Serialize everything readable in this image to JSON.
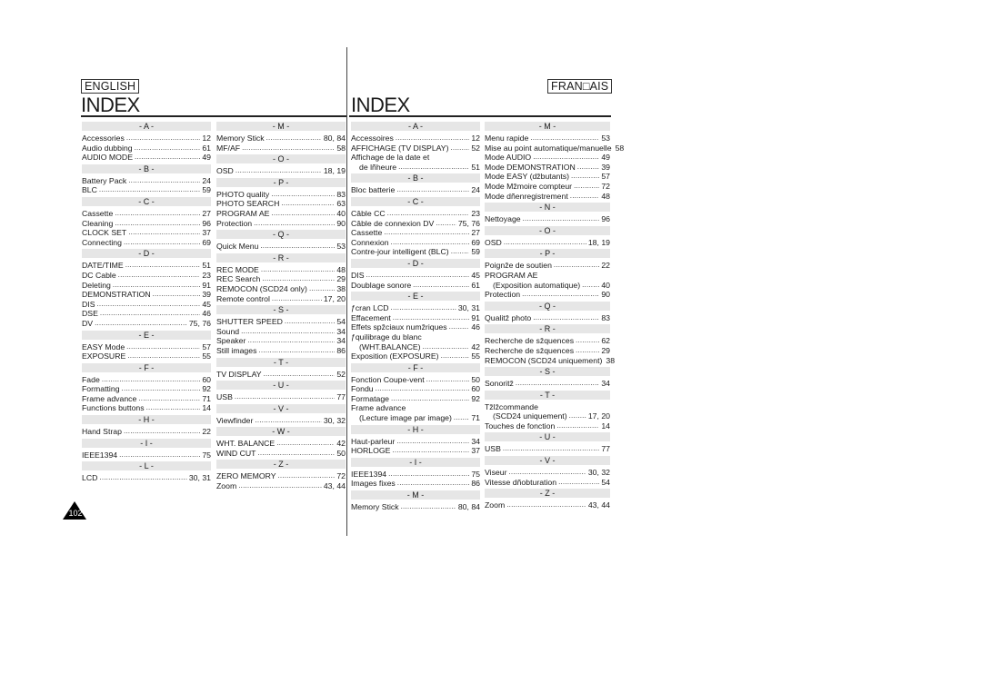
{
  "english": {
    "language_label": "ENGLISH",
    "title": "INDEX",
    "columns": [
      [
        {
          "type": "header",
          "text": "- A -"
        },
        {
          "label": "Accessories",
          "page": "12"
        },
        {
          "label": "Audio dubbing",
          "page": "61"
        },
        {
          "label": "AUDIO MODE",
          "page": "49"
        },
        {
          "type": "header",
          "text": "- B -"
        },
        {
          "label": "Battery Pack",
          "page": "24"
        },
        {
          "label": "BLC",
          "page": "59"
        },
        {
          "type": "header",
          "text": "- C -"
        },
        {
          "label": "Cassette",
          "page": "27"
        },
        {
          "label": "Cleaning",
          "page": "96"
        },
        {
          "label": "CLOCK SET",
          "page": "37"
        },
        {
          "label": "Connecting",
          "page": "69"
        },
        {
          "type": "header",
          "text": "- D -"
        },
        {
          "label": "DATE/TIME",
          "page": "51"
        },
        {
          "label": "DC Cable",
          "page": "23"
        },
        {
          "label": "Deleting",
          "page": "91"
        },
        {
          "label": "DEMONSTRATION",
          "page": "39"
        },
        {
          "label": "DIS",
          "page": "45"
        },
        {
          "label": "DSE",
          "page": "46"
        },
        {
          "label": "DV",
          "page": "75, 76"
        },
        {
          "type": "header",
          "text": "- E -"
        },
        {
          "label": "EASY Mode",
          "page": "57"
        },
        {
          "label": "EXPOSURE",
          "page": "55"
        },
        {
          "type": "header",
          "text": "- F -"
        },
        {
          "label": "Fade",
          "page": "60"
        },
        {
          "label": "Formatting",
          "page": "92"
        },
        {
          "label": "Frame advance",
          "page": "71"
        },
        {
          "label": "Functions buttons",
          "page": "14"
        },
        {
          "type": "header",
          "text": "- H -"
        },
        {
          "label": "Hand Strap",
          "page": "22"
        },
        {
          "type": "header",
          "text": "- I -"
        },
        {
          "label": "IEEE1394",
          "page": "75"
        },
        {
          "type": "header",
          "text": "- L -"
        },
        {
          "label": "LCD",
          "page": "30, 31"
        }
      ],
      [
        {
          "type": "header",
          "text": "- M -"
        },
        {
          "label": "Memory Stick",
          "page": "80, 84"
        },
        {
          "label": "MF/AF",
          "page": "58"
        },
        {
          "type": "header",
          "text": "- O -"
        },
        {
          "label": "OSD",
          "page": "18, 19"
        },
        {
          "type": "header",
          "text": "- P -"
        },
        {
          "label": "PHOTO quality",
          "page": "83"
        },
        {
          "label": "PHOTO SEARCH",
          "page": "63"
        },
        {
          "label": "PROGRAM AE",
          "page": "40"
        },
        {
          "label": "Protection",
          "page": "90"
        },
        {
          "type": "header",
          "text": "- Q -"
        },
        {
          "label": "Quick Menu",
          "page": "53"
        },
        {
          "type": "header",
          "text": "- R -"
        },
        {
          "label": "REC MODE",
          "page": "48"
        },
        {
          "label": "REC Search",
          "page": "29"
        },
        {
          "label": "REMOCON (SCD24 only)",
          "page": "38"
        },
        {
          "label": "Remote control",
          "page": "17, 20"
        },
        {
          "type": "header",
          "text": "- S -"
        },
        {
          "label": "SHUTTER SPEED",
          "page": "54"
        },
        {
          "label": "Sound",
          "page": "34"
        },
        {
          "label": "Speaker",
          "page": "34"
        },
        {
          "label": "Still images",
          "page": "86"
        },
        {
          "type": "header",
          "text": "- T -"
        },
        {
          "label": "TV DISPLAY",
          "page": "52"
        },
        {
          "type": "header",
          "text": "- U -"
        },
        {
          "label": "USB",
          "page": "77"
        },
        {
          "type": "header",
          "text": "- V -"
        },
        {
          "label": "Viewfinder",
          "page": "30, 32"
        },
        {
          "type": "header",
          "text": "- W -"
        },
        {
          "label": "WHT. BALANCE",
          "page": "42"
        },
        {
          "label": "WIND CUT",
          "page": "50"
        },
        {
          "type": "header",
          "text": "- Z -"
        },
        {
          "label": "ZERO MEMORY",
          "page": "72"
        },
        {
          "label": "Zoom",
          "page": "43, 44"
        }
      ]
    ]
  },
  "french": {
    "language_label": "FRAN□AIS",
    "title": "INDEX",
    "columns": [
      [
        {
          "type": "header",
          "text": "- A -"
        },
        {
          "label": "Accessoires",
          "page": "12"
        },
        {
          "label": "AFFICHAGE (TV DISPLAY)",
          "page": "52"
        },
        {
          "label": "Affichage de la date et",
          "page": ""
        },
        {
          "label": "de lñheure",
          "page": "51",
          "cont": true
        },
        {
          "type": "header",
          "text": "- B -"
        },
        {
          "label": "Bloc batterie",
          "page": "24"
        },
        {
          "type": "header",
          "text": "- C -"
        },
        {
          "label": "Câble CC",
          "page": "23"
        },
        {
          "label": "Câble de connexion DV",
          "page": "75, 76"
        },
        {
          "label": "Cassette",
          "page": "27"
        },
        {
          "label": "Connexion",
          "page": "69"
        },
        {
          "label": "Contre-jour intelligent (BLC)",
          "page": "59"
        },
        {
          "type": "header",
          "text": "- D -"
        },
        {
          "label": "DIS",
          "page": "45"
        },
        {
          "label": "Doublage sonore",
          "page": "61"
        },
        {
          "type": "header",
          "text": "- E -"
        },
        {
          "label": "ƒcran LCD",
          "page": "30, 31"
        },
        {
          "label": "Effacement",
          "page": "91"
        },
        {
          "label": "Effets spžciaux numžriques",
          "page": "46"
        },
        {
          "label": "ƒquilibrage du blanc",
          "page": ""
        },
        {
          "label": "(WHT.BALANCE)",
          "page": "42",
          "cont": true
        },
        {
          "label": "Exposition (EXPOSURE)",
          "page": "55"
        },
        {
          "type": "header",
          "text": "- F -"
        },
        {
          "label": "Fonction Coupe-vent",
          "page": "50"
        },
        {
          "label": "Fondu",
          "page": "60"
        },
        {
          "label": "Formatage",
          "page": "92"
        },
        {
          "label": "Frame advance",
          "page": ""
        },
        {
          "label": "(Lecture image par image)",
          "page": "71",
          "cont": true
        },
        {
          "type": "header",
          "text": "- H -"
        },
        {
          "label": "Haut-parleur",
          "page": "34"
        },
        {
          "label": "HORLOGE",
          "page": "37"
        },
        {
          "type": "header",
          "text": "- I -"
        },
        {
          "label": "IEEE1394",
          "page": "75"
        },
        {
          "label": "Images fixes",
          "page": "86"
        },
        {
          "type": "header",
          "text": "- M -"
        },
        {
          "label": "Memory Stick",
          "page": "80, 84"
        }
      ],
      [
        {
          "type": "header",
          "text": "- M -"
        },
        {
          "label": "Menu rapide",
          "page": "53"
        },
        {
          "label": "Mise au point automatique/manuelle",
          "page": "58"
        },
        {
          "label": "Mode AUDIO",
          "page": "49"
        },
        {
          "label": "Mode DEMONSTRATION",
          "page": "39"
        },
        {
          "label": "Mode EASY (džbutants)",
          "page": "57"
        },
        {
          "label": "Mode Mžmoire compteur",
          "page": "72"
        },
        {
          "label": "Mode dñenregistrement",
          "page": "48"
        },
        {
          "type": "header",
          "text": "- N -"
        },
        {
          "label": "Nettoyage",
          "page": "96"
        },
        {
          "type": "header",
          "text": "- O -"
        },
        {
          "label": "OSD",
          "page": "18, 19"
        },
        {
          "type": "header",
          "text": "- P -"
        },
        {
          "label": "Poignže de soutien",
          "page": "22"
        },
        {
          "label": "PROGRAM AE",
          "page": ""
        },
        {
          "label": "(Exposition automatique)",
          "page": "40",
          "cont": true
        },
        {
          "label": "Protection",
          "page": "90"
        },
        {
          "type": "header",
          "text": "- Q -"
        },
        {
          "label": "Qualitž photo",
          "page": "83"
        },
        {
          "type": "header",
          "text": "- R -"
        },
        {
          "label": "Recherche de sžquences",
          "page": "62"
        },
        {
          "label": "Recherche de sžquences",
          "page": "29"
        },
        {
          "label": "REMOCON (SCD24 uniquement)",
          "page": "38"
        },
        {
          "type": "header",
          "text": "- S -"
        },
        {
          "label": "Sonoritž",
          "page": "34"
        },
        {
          "type": "header",
          "text": "- T -"
        },
        {
          "label": "Tžlžcommande",
          "page": ""
        },
        {
          "label": "(SCD24 uniquement)",
          "page": "17, 20",
          "cont": true
        },
        {
          "label": "Touches de fonction",
          "page": "14"
        },
        {
          "type": "header",
          "text": "- U -"
        },
        {
          "label": "USB",
          "page": "77"
        },
        {
          "type": "header",
          "text": "- V -"
        },
        {
          "label": "Viseur",
          "page": "30, 32"
        },
        {
          "label": "Vitesse dñobturation",
          "page": "54"
        },
        {
          "type": "header",
          "text": "- Z -"
        },
        {
          "label": "Zoom",
          "page": "43, 44"
        }
      ]
    ]
  },
  "page_number": "102",
  "page_badge_icon": "triangle-page-marker"
}
